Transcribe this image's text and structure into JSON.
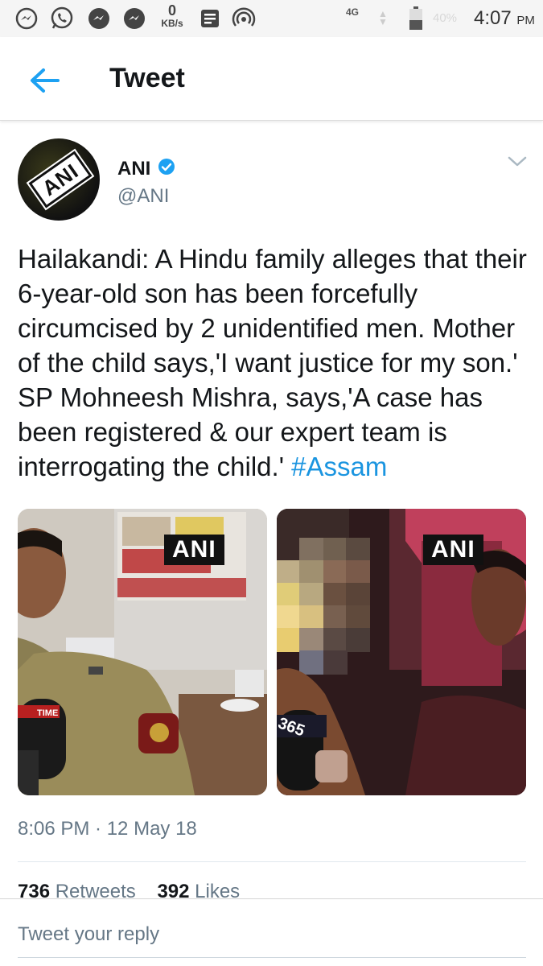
{
  "status_bar": {
    "kbs_value": "0",
    "kbs_unit": "KB/s",
    "network": "4G",
    "battery": "40%",
    "time": "4:07",
    "ampm": "PM",
    "icons": [
      "messenger-icon",
      "whatsapp-icon",
      "messenger-icon",
      "messenger-icon",
      "notes-icon",
      "hotspot-icon"
    ]
  },
  "appbar": {
    "title": "Tweet",
    "back_icon": "arrow-left-icon"
  },
  "tweet": {
    "author_name": "ANI",
    "author_handle": "@ANI",
    "text": "Hailakandi: A Hindu family alleges that their 6-year-old son has been forcefully circumcised by 2 unidentified men. Mother of the child says,'I want justice for my son.' SP Mohneesh Mishra, says,'A case has been registered & our expert team is interrogating the child.' ",
    "hashtag": "#Assam",
    "media": [
      {
        "watermark": "ANI",
        "mic_label": "TIME"
      },
      {
        "watermark": "ANI",
        "mic_label": "365"
      }
    ],
    "timestamp": "8:06 PM · 12 May 18",
    "retweets_count": "736",
    "retweets_label": "Retweets",
    "likes_count": "392",
    "likes_label": "Likes"
  },
  "reply": {
    "placeholder": "Tweet your reply"
  },
  "colors": {
    "accent": "#1da1f2",
    "link": "#1b95e0",
    "muted": "#657786"
  }
}
